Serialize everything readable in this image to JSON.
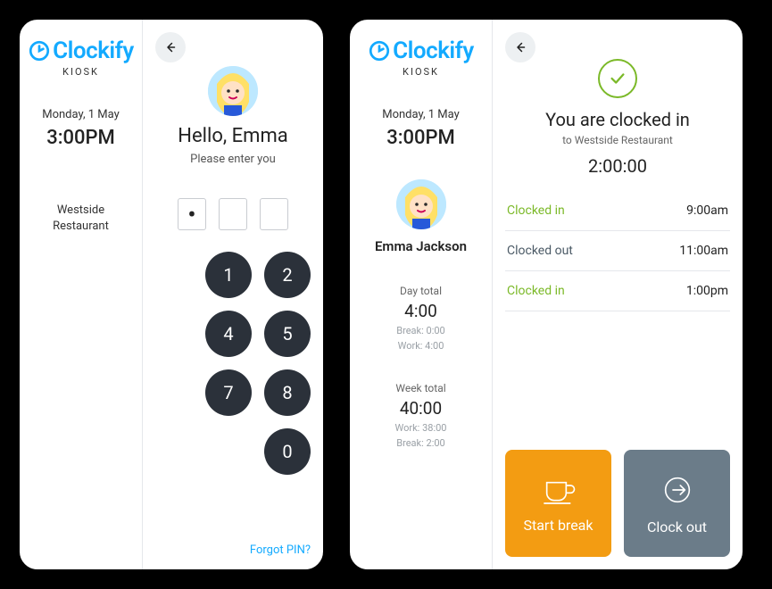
{
  "brand": {
    "name": "Clockify",
    "sublabel": "KIOSK"
  },
  "datetime": {
    "date": "Monday, 1 May",
    "time": "3:00PM"
  },
  "location": "Westside\nRestaurant",
  "pin_screen": {
    "greeting": "Hello, Emma",
    "prompt": "Please enter you",
    "entered_count": 1,
    "keys": [
      "1",
      "2",
      "4",
      "5",
      "7",
      "8",
      "0"
    ],
    "forgot": "Forgot PIN?"
  },
  "user": {
    "name": "Emma Jackson",
    "day_total_label": "Day total",
    "day_total": "4:00",
    "day_break": "Break: 0:00",
    "day_work": "Work: 4:00",
    "week_total_label": "Week total",
    "week_total": "40:00",
    "week_work": "Work: 38:00",
    "week_break": "Break: 2:00"
  },
  "status": {
    "title": "You are clocked in",
    "subtitle": "to Westside Restaurant",
    "duration": "2:00:00"
  },
  "log": [
    {
      "label": "Clocked in",
      "kind": "in",
      "time": "9:00am"
    },
    {
      "label": "Clocked out",
      "kind": "out",
      "time": "11:00am"
    },
    {
      "label": "Clocked in",
      "kind": "in",
      "time": "1:00pm"
    }
  ],
  "actions": {
    "start_break": "Start break",
    "clock_out": "Clock out"
  }
}
